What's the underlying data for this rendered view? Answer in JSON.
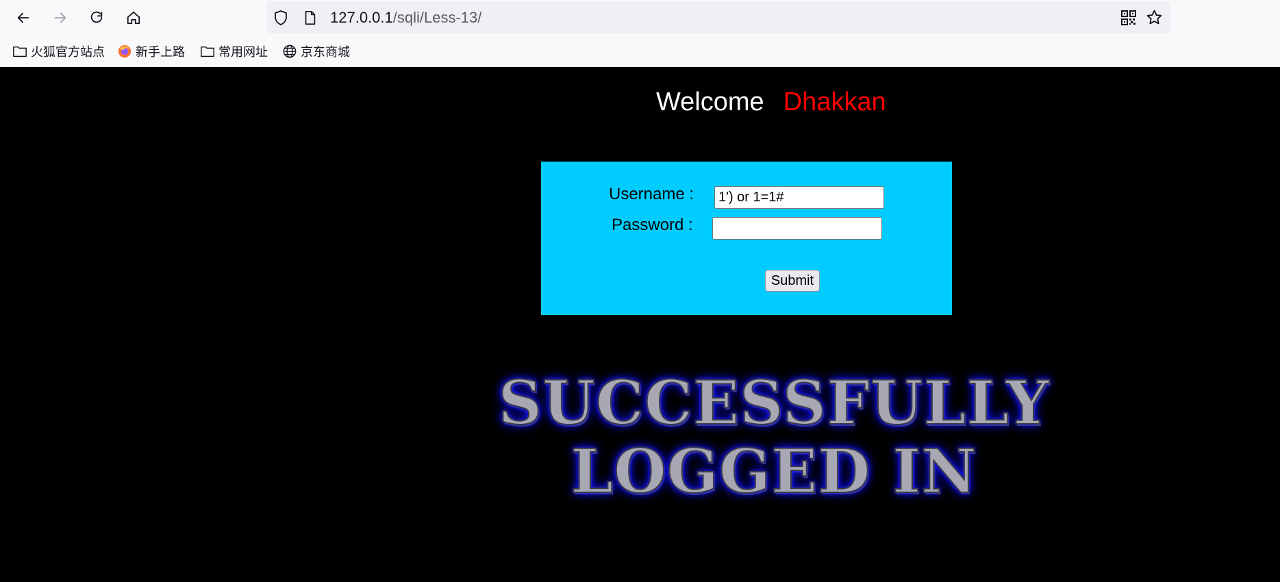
{
  "browser": {
    "url_host": "127.0.0.1",
    "url_path": "/sqli/Less-13/",
    "icons": [
      "back-icon",
      "forward-icon",
      "reload-icon",
      "home-icon",
      "shield-icon",
      "page-icon",
      "qr-code-icon",
      "star-icon"
    ]
  },
  "bookmarks": [
    {
      "label": "火狐官方站点",
      "icon": "folder-icon"
    },
    {
      "label": "新手上路",
      "icon": "firefox-icon"
    },
    {
      "label": "常用网址",
      "icon": "folder-icon"
    },
    {
      "label": "京东商城",
      "icon": "globe-icon"
    }
  ],
  "page": {
    "welcome": "Welcome",
    "name": "Dhakkan",
    "username_label": "Username :",
    "password_label": "Password :",
    "username_value": "1') or 1=1#",
    "password_value": "",
    "submit_label": "Submit",
    "success_line1": "SUCCESSFULLY",
    "success_line2": "LOGGED IN"
  },
  "colors": {
    "page_bg": "#000000",
    "form_bg": "#00ccff",
    "name_color": "#ff0000"
  }
}
